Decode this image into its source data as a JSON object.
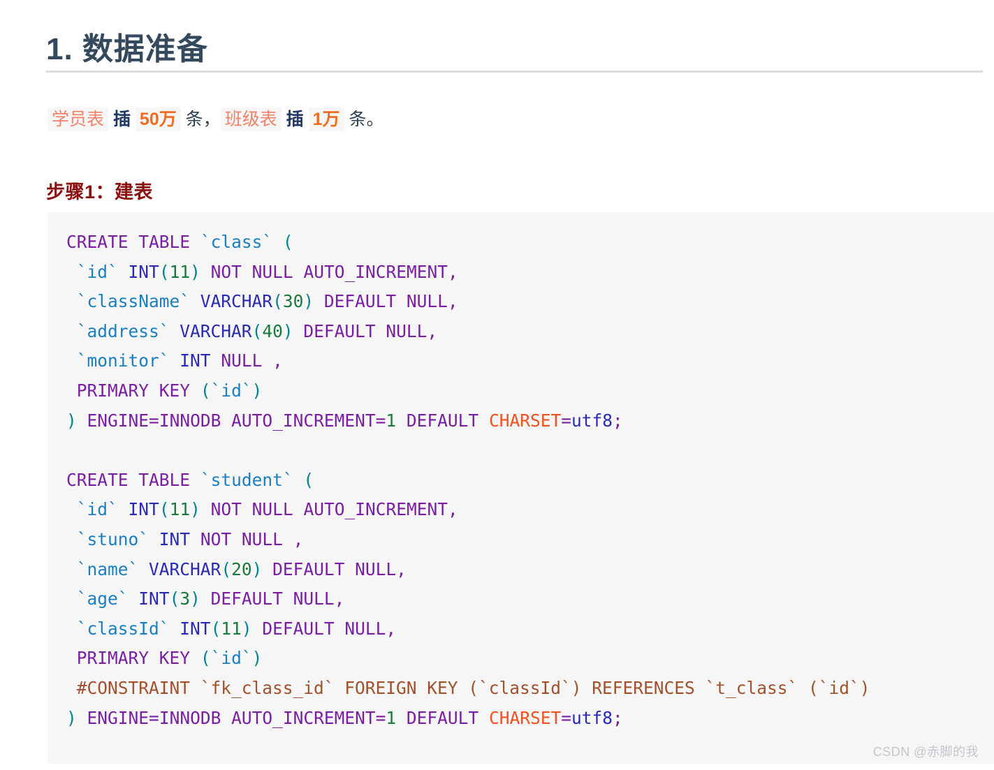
{
  "document": {
    "title": "1. 数据准备",
    "intro": {
      "segments": [
        {
          "text": "学员表",
          "style": "hl-table"
        },
        {
          "text": " 插 ",
          "style": "plain"
        },
        {
          "text": "50万",
          "style": "hl-num"
        },
        {
          "text": " 条，",
          "style": "tail"
        },
        {
          "text": "班级表",
          "style": "hl-table"
        },
        {
          "text": " 插 ",
          "style": "plain"
        },
        {
          "text": "1万",
          "style": "hl-num"
        },
        {
          "text": " 条。",
          "style": "tail"
        }
      ],
      "full_text": "学员表 插 50万 条， 班级表 插 1万 条。"
    },
    "step_heading": "步骤1：建表",
    "watermark": "CSDN @赤脚的我"
  },
  "code_block": {
    "language": "sql",
    "lines": [
      {
        "n": 1,
        "text": "CREATE TABLE `class` ("
      },
      {
        "n": 2,
        "text": " `id` INT(11) NOT NULL AUTO_INCREMENT,"
      },
      {
        "n": 3,
        "text": " `className` VARCHAR(30) DEFAULT NULL,"
      },
      {
        "n": 4,
        "text": " `address` VARCHAR(40) DEFAULT NULL,"
      },
      {
        "n": 5,
        "text": " `monitor` INT NULL ,"
      },
      {
        "n": 6,
        "text": " PRIMARY KEY (`id`)"
      },
      {
        "n": 7,
        "text": ") ENGINE=INNODB AUTO_INCREMENT=1 DEFAULT CHARSET=utf8;"
      },
      {
        "n": 8,
        "text": ""
      },
      {
        "n": 9,
        "text": "CREATE TABLE `student` ("
      },
      {
        "n": 10,
        "text": " `id` INT(11) NOT NULL AUTO_INCREMENT,"
      },
      {
        "n": 11,
        "text": " `stuno` INT NOT NULL ,"
      },
      {
        "n": 12,
        "text": " `name` VARCHAR(20) DEFAULT NULL,"
      },
      {
        "n": 13,
        "text": " `age` INT(3) DEFAULT NULL,"
      },
      {
        "n": 14,
        "text": " `classId` INT(11) DEFAULT NULL,"
      },
      {
        "n": 15,
        "text": " PRIMARY KEY (`id`)"
      },
      {
        "n": 16,
        "text": " #CONSTRAINT `fk_class_id` FOREIGN KEY (`classId`) REFERENCES `t_class` (`id`)"
      },
      {
        "n": 17,
        "text": ") ENGINE=INNODB AUTO_INCREMENT=1 DEFAULT CHARSET=utf8;"
      }
    ],
    "tables": [
      "class",
      "student"
    ],
    "columns": {
      "class": [
        "id",
        "className",
        "address",
        "monitor"
      ],
      "student": [
        "id",
        "stuno",
        "name",
        "age",
        "classId"
      ]
    }
  },
  "colors": {
    "title": "#34495e",
    "rule": "#dcdcdc",
    "step_heading": "#8b1010",
    "highlight_table_text": "#f2836b",
    "highlight_number_text": "#f26b1f",
    "highlight_bg": "#f6f6f6",
    "code_bg": "#f6f6f7",
    "keyword": "#7b1fa2",
    "identifier": "#1a7fc1",
    "type": "#2a2ab5",
    "number": "#1a7a3c",
    "punctuation": "#00838f",
    "charset": "#f4511e",
    "comment": "#a0522d",
    "watermark": "#c3c6ca"
  }
}
